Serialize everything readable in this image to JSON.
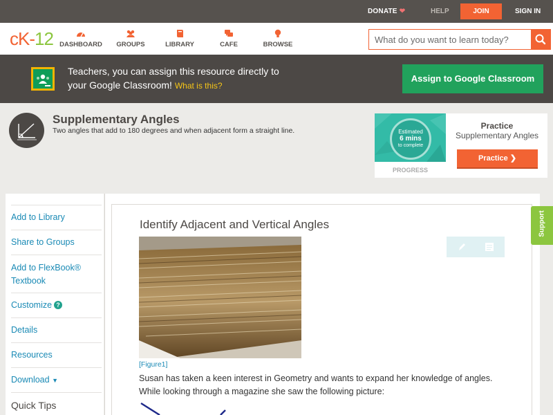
{
  "topbar": {
    "donate": "DONATE",
    "help": "HELP",
    "join": "JOIN",
    "signin": "SIGN IN"
  },
  "logo": {
    "ck": "cK",
    "dash": "-",
    "num": "12"
  },
  "nav": [
    {
      "label": "DASHBOARD",
      "icon": "dashboard-icon"
    },
    {
      "label": "GROUPS",
      "icon": "groups-icon"
    },
    {
      "label": "LIBRARY",
      "icon": "library-icon"
    },
    {
      "label": "CAFE",
      "icon": "cafe-icon"
    },
    {
      "label": "BROWSE",
      "icon": "browse-icon"
    }
  ],
  "search": {
    "placeholder": "What do you want to learn today?"
  },
  "banner": {
    "line1": "Teachers, you can assign this resource directly to",
    "line2": "your Google Classroom!",
    "what": "What is this?",
    "assign": "Assign to Google Classroom"
  },
  "concept": {
    "title": "Supplementary Angles",
    "desc": "Two angles that add to 180 degrees and when adjacent form a straight line."
  },
  "practice": {
    "estimated": "Estimated",
    "mins": "6 mins",
    "complete": "to complete",
    "progress": "PROGRESS",
    "heading": "Practice",
    "subject": "Supplementary Angles",
    "button": "Practice"
  },
  "sidebar": {
    "items": [
      "Add to Library",
      "Share to Groups",
      "Add to FlexBook®",
      "Textbook",
      "Customize",
      "Details",
      "Resources",
      "Download"
    ],
    "help_mark": "?",
    "quick_tips": "Quick Tips"
  },
  "content": {
    "title": "Identify Adjacent and Vertical Angles",
    "figure": "[Figure1]",
    "p1": "Susan has taken a keen interest in Geometry and wants to expand her knowledge of angles.",
    "p2": "While looking through a magazine she saw the following picture:"
  },
  "support": "Support",
  "colors": {
    "accent": "#f26333",
    "green": "#21a25c",
    "link": "#1a8ab5",
    "teal": "#33bba7"
  }
}
